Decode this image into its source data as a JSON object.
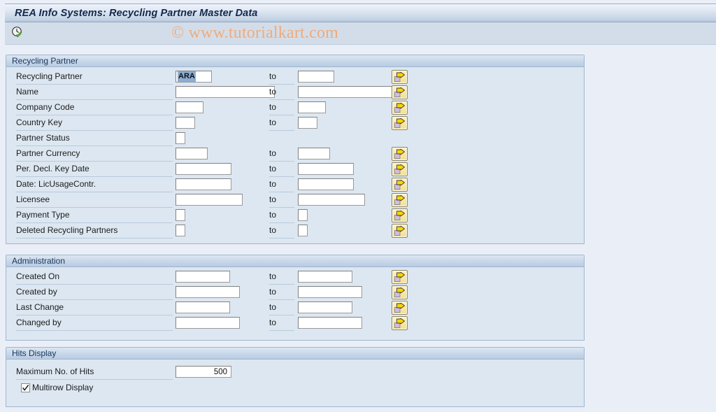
{
  "window": {
    "title": "REA Info Systems: Recycling Partner Master Data"
  },
  "toolbar": {
    "execute_icon": "clock-check-icon",
    "watermark": "© www.tutorialkart.com"
  },
  "labels": {
    "to": "to",
    "select_options": "multiple-selection"
  },
  "colors": {
    "accent": "#18355c",
    "groupbox_border": "#9db6d2",
    "groupbox_body": "#dde7f1",
    "page_background": "#eaeff7",
    "watermark": "#efab7c",
    "selection_highlight": "#8aaed4",
    "button_yellow": "#f7e9a8"
  },
  "groups": [
    {
      "title": "Recycling Partner",
      "rows": [
        {
          "label": "Recycling Partner",
          "value": "ARA",
          "selected": true,
          "w1": 52,
          "w2": 52,
          "has_to": true,
          "has_arrow": true
        },
        {
          "label": "Name",
          "value": "",
          "selected": false,
          "w1": 142,
          "w2": 142,
          "has_to": true,
          "has_arrow": true
        },
        {
          "label": "Company Code",
          "value": "",
          "selected": false,
          "w1": 40,
          "w2": 40,
          "has_to": true,
          "has_arrow": true
        },
        {
          "label": "Country Key",
          "value": "",
          "selected": false,
          "w1": 28,
          "w2": 28,
          "has_to": true,
          "has_arrow": true
        },
        {
          "label": "Partner Status",
          "value": "",
          "selected": false,
          "w1": 14,
          "w2": 0,
          "has_to": false,
          "has_arrow": false
        },
        {
          "label": "Partner Currency",
          "value": "",
          "selected": false,
          "w1": 46,
          "w2": 46,
          "has_to": true,
          "has_arrow": true
        },
        {
          "label": "Per. Decl. Key Date",
          "value": "",
          "selected": false,
          "w1": 80,
          "w2": 80,
          "has_to": true,
          "has_arrow": true
        },
        {
          "label": "Date: LicUsageContr.",
          "value": "",
          "selected": false,
          "w1": 80,
          "w2": 80,
          "has_to": true,
          "has_arrow": true
        },
        {
          "label": "Licensee",
          "value": "",
          "selected": false,
          "w1": 96,
          "w2": 96,
          "has_to": true,
          "has_arrow": true
        },
        {
          "label": "Payment Type",
          "value": "",
          "selected": false,
          "w1": 14,
          "w2": 14,
          "has_to": true,
          "has_arrow": true
        },
        {
          "label": "Deleted Recycling Partners",
          "value": "",
          "selected": false,
          "w1": 14,
          "w2": 14,
          "has_to": true,
          "has_arrow": true
        }
      ]
    },
    {
      "title": "Administration",
      "rows": [
        {
          "label": "Created On",
          "value": "",
          "selected": false,
          "w1": 78,
          "w2": 78,
          "has_to": true,
          "has_arrow": true
        },
        {
          "label": "Created by",
          "value": "",
          "selected": false,
          "w1": 92,
          "w2": 92,
          "has_to": true,
          "has_arrow": true
        },
        {
          "label": "Last Change",
          "value": "",
          "selected": false,
          "w1": 78,
          "w2": 78,
          "has_to": true,
          "has_arrow": true
        },
        {
          "label": "Changed by",
          "value": "",
          "selected": false,
          "w1": 92,
          "w2": 92,
          "has_to": true,
          "has_arrow": true
        }
      ]
    }
  ],
  "hits_display": {
    "title": "Hits Display",
    "max_hits_label": "Maximum No. of Hits",
    "max_hits_value": "500",
    "multirow_label": "Multirow Display",
    "multirow_checked": true
  }
}
